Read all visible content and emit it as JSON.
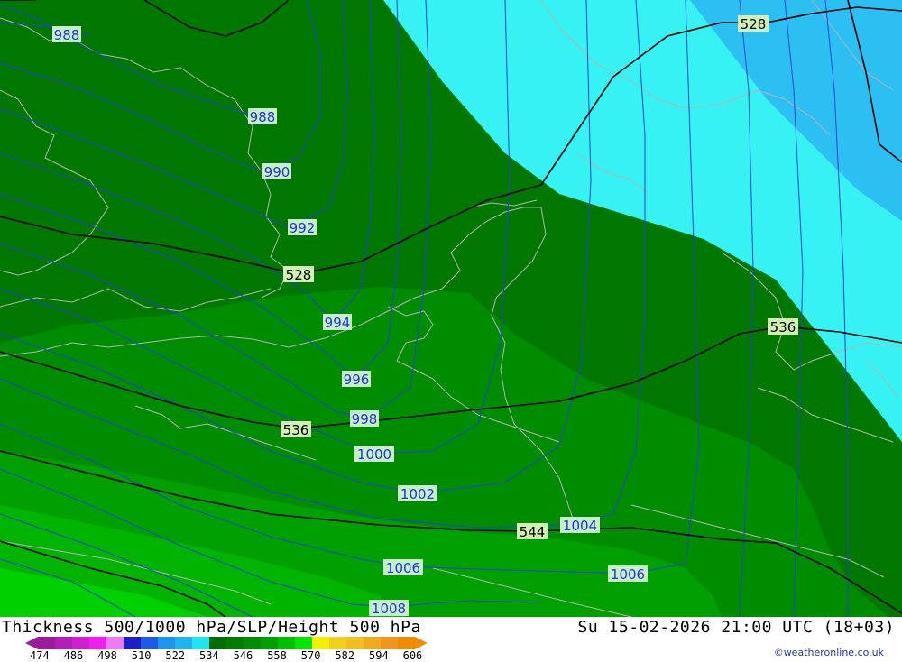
{
  "map": {
    "slp_labels": [
      "988",
      "988",
      "990",
      "992",
      "994",
      "996",
      "998",
      "1000",
      "1002",
      "1004",
      "1006",
      "1006",
      "1008"
    ],
    "thickness_labels": [
      "528",
      "528",
      "536",
      "536",
      "544"
    ]
  },
  "footer": {
    "title": "Thickness 500/1000 hPa/SLP/Height 500 hPa",
    "datetime": "Su 15-02-2026 21:00 UTC (18+03)",
    "credit": "©weatheronline.co.uk",
    "scale_ticks": [
      "474",
      "486",
      "498",
      "510",
      "522",
      "534",
      "546",
      "558",
      "570",
      "582",
      "594",
      "606"
    ],
    "scale_colors": [
      "#9a1e9a",
      "#b41eb4",
      "#d21ed2",
      "#f01ef0",
      "#f078f0",
      "#1e1ec8",
      "#1e5ae6",
      "#1e96f0",
      "#1eb4f0",
      "#1ee6f0",
      "#006e00",
      "#007d00",
      "#008c00",
      "#00a000",
      "#00be00",
      "#00e600",
      "#f0f000",
      "#f0d21e",
      "#f0be1e",
      "#f0aa1e",
      "#f0961e",
      "#f08c00"
    ]
  }
}
